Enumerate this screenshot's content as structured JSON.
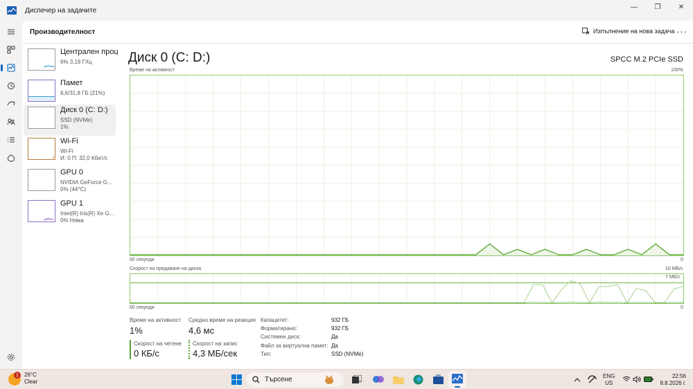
{
  "window": {
    "title": "Диспечер на задачите",
    "minimize_glyph": "—",
    "maximize_glyph": "❐",
    "close_glyph": "✕"
  },
  "header": {
    "page_title": "Производителност",
    "run_task_label": "Изпълнение на нова задача",
    "more_glyph": "···"
  },
  "devices": [
    {
      "name": "Централен процесор",
      "line1": "6% 3,19 ГХц",
      "line2": ""
    },
    {
      "name": "Памет",
      "line1": "6,6/31,8 ГБ (21%)",
      "line2": ""
    },
    {
      "name": "Диск 0 (C: D:)",
      "line1": "SSD (NVMe)",
      "line2": "1%"
    },
    {
      "name": "Wi-Fi",
      "line1": "Wi-Fi",
      "line2": "И: 0 П: 32,0 Кбит/с"
    },
    {
      "name": "GPU 0",
      "line1": "NVIDIA GeForce GTX...",
      "line2": "0% (44°C)"
    },
    {
      "name": "GPU 1",
      "line1": "Intel(R) Iris(R) Xe Gra...",
      "line2": "0% Няма"
    }
  ],
  "detail": {
    "title": "Диск 0 (C: D:)",
    "model": "SPCC M.2 PCIe SSD",
    "graph1": {
      "label": "Време на активност",
      "max": "100%",
      "time": "60 секунди",
      "min": "0"
    },
    "graph2": {
      "label": "Скорост на предаване на диска",
      "max": "10 МБ/с",
      "inner_max": "7 МБ/с",
      "time": "60 секунди",
      "min": "0"
    }
  },
  "stats": {
    "active_time_label": "Време на активност",
    "active_time_value": "1%",
    "response_label": "Средно време на реакция",
    "response_value": "4,6 мс",
    "read_label": "Скорост на четене",
    "read_value": "0 КБ/с",
    "write_label": "Скорост на запис",
    "write_value": "4,3 МБ/сек"
  },
  "properties": [
    {
      "label": "Капацитет:",
      "value": "932 ГБ"
    },
    {
      "label": "Форматирано:",
      "value": "932 ГБ"
    },
    {
      "label": "Системен диск:",
      "value": "Да"
    },
    {
      "label": "Файл за виртуална памет:",
      "value": "Да"
    },
    {
      "label": "Тип:",
      "value": "SSD (NVMe)"
    }
  ],
  "chart_data": [
    {
      "type": "area",
      "title": "Време на активност",
      "ylabel": "",
      "ylim": [
        0,
        100
      ],
      "x": [
        0,
        4,
        6,
        8,
        10,
        12,
        14,
        16,
        18,
        20,
        22,
        24,
        26,
        28,
        30,
        32,
        34,
        36,
        38,
        40,
        42,
        44,
        46,
        48,
        50,
        52,
        54,
        56,
        58,
        60
      ],
      "series": [
        {
          "values": [
            0,
            0,
            0,
            0,
            0,
            0,
            0,
            0,
            0,
            0,
            0,
            0,
            0,
            0,
            0,
            0,
            0,
            0,
            0,
            0,
            0,
            0,
            0,
            0,
            0,
            0,
            0,
            0,
            0,
            0
          ]
        }
      ],
      "tail": [
        0,
        0,
        0,
        0,
        2,
        0,
        1,
        0,
        1,
        0,
        0,
        1,
        0,
        0,
        1,
        0,
        2,
        0
      ]
    },
    {
      "type": "line",
      "title": "Скорост на предаване на диска",
      "ylim": [
        0,
        10
      ],
      "x": [
        0,
        1,
        2,
        3,
        4,
        5,
        6,
        7,
        8,
        9,
        10,
        11,
        12,
        13,
        14,
        15,
        16,
        17,
        18,
        19,
        20,
        21,
        22,
        23,
        24,
        25,
        26,
        27,
        28,
        29,
        30,
        31,
        32,
        33,
        34,
        35,
        36,
        37,
        38,
        39,
        40,
        41,
        42,
        43,
        44,
        45,
        46,
        47,
        48,
        49,
        50,
        51,
        52,
        53,
        54,
        55,
        56,
        57,
        58,
        59
      ],
      "series": [
        {
          "values": [
            0,
            0,
            0,
            0,
            0,
            0,
            0,
            0,
            0,
            0,
            0,
            0,
            0,
            0,
            0,
            0,
            0,
            0,
            0,
            0,
            0,
            0,
            0,
            0,
            0,
            0,
            0,
            0,
            0,
            0,
            0,
            0,
            0,
            0,
            0,
            0,
            0,
            0,
            0,
            0,
            0,
            0,
            0,
            6.2,
            6.2,
            0,
            4.5,
            7.6,
            6.5,
            0,
            5.6,
            5.6,
            6.3,
            0,
            4.9,
            4.2,
            0,
            0,
            4.8,
            5.6
          ]
        },
        {
          "values": [
            0,
            0,
            0,
            0,
            0,
            0,
            0,
            0,
            0,
            0,
            0,
            0,
            0,
            0,
            0,
            0,
            0,
            0,
            0,
            0,
            0,
            0,
            0,
            0,
            0,
            0,
            0,
            0,
            0,
            0,
            0,
            0,
            0,
            0,
            0,
            0,
            0,
            0,
            0,
            0,
            0,
            0,
            0,
            0.2,
            0.1,
            0,
            0.1,
            0.2,
            0.1,
            0,
            0.2,
            0.1,
            0.2,
            0,
            0.1,
            0.1,
            0,
            0,
            0.1,
            0.1
          ]
        }
      ]
    }
  ],
  "taskbar": {
    "temperature": "26°C",
    "condition": "Clear",
    "badge": "1",
    "search_placeholder": "Търсене",
    "lang_line1": "ENG",
    "lang_line2": "US",
    "time": "22:56",
    "date": "8.8.2026 г."
  }
}
